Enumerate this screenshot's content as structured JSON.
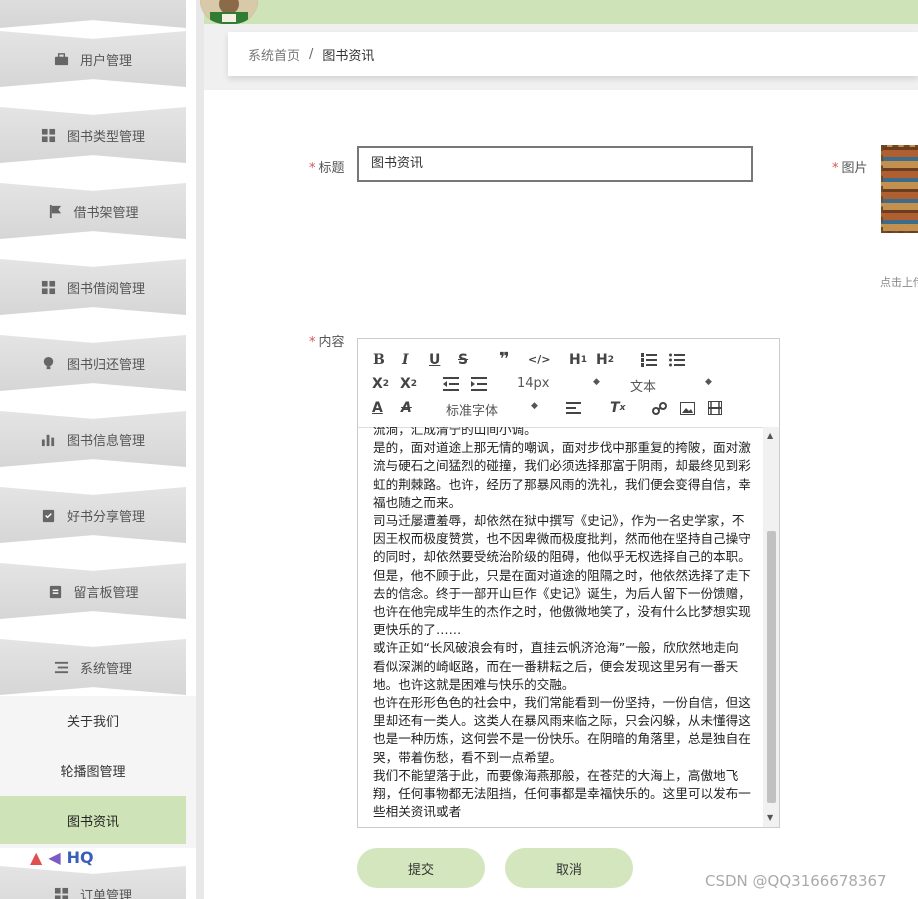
{
  "sidebar": {
    "menu": [
      {
        "label": "用户管理",
        "icon": "briefcase-icon"
      },
      {
        "label": "图书类型管理",
        "icon": "grid-icon"
      },
      {
        "label": "借书架管理",
        "icon": "flag-icon"
      },
      {
        "label": "图书借阅管理",
        "icon": "grid-icon"
      },
      {
        "label": "图书归还管理",
        "icon": "lightbulb-icon"
      },
      {
        "label": "图书信息管理",
        "icon": "bar-chart-icon"
      },
      {
        "label": "好书分享管理",
        "icon": "clipboard-check-icon"
      },
      {
        "label": "留言板管理",
        "icon": "clipboard-icon"
      },
      {
        "label": "系统管理",
        "icon": "list-icon"
      }
    ],
    "submenu": [
      "关于我们",
      "轮播图管理",
      "图书资讯"
    ],
    "order": {
      "label": "订单管理",
      "icon": "grid-icon"
    },
    "logo_text": "HQ"
  },
  "breadcrumb": {
    "home": "系统首页",
    "separator": "/",
    "current": "图书资讯"
  },
  "form": {
    "title_label": "标题",
    "title_value": "图书资讯",
    "image_label": "图片",
    "upload_tip": "点击上传",
    "content_label": "内容",
    "required_mark": "*"
  },
  "editor": {
    "font_size": "14px",
    "paragraph": "文本",
    "font_family": "标准字体",
    "toolbar_icons": [
      "bold-icon",
      "italic-icon",
      "underline-icon",
      "strike-icon",
      "quote-icon",
      "code-icon",
      "h1-icon",
      "h2-icon",
      "ordered-list-icon",
      "bullet-list-icon",
      "subscript-icon",
      "superscript-icon",
      "outdent-icon",
      "indent-icon",
      "font-color-icon",
      "highlight-icon",
      "align-icon",
      "clear-format-icon",
      "link-icon",
      "image-icon",
      "video-icon"
    ],
    "content": [
      "流淌，汇成清宁的山间小调。",
      "是的，面对道途上那无情的嘲讽，面对步伐中那重复的挎陂，面对激流与硬石之间猛烈的碰撞，我们必须选择那富于阴雨，却最终见到彩虹的荆棘路。也许，经历了那暴风雨的洗礼，我们便会变得自信，幸福也随之而来。",
      "司马迁屡遭羞辱，却依然在狱中撰写《史记》，作为一名史学家，不因王权而极度赞赏，也不因卑微而极度批判，然而他在坚持自己操守的同时，却依然要受统治阶级的阻碍，他似乎无权选择自己的本职。但是，他不顾于此，只是在面对道途的阻隔之时，他依然选择了走下去的信念。终于一部开山巨作《史记》诞生，为后人留下一份馈赠，也许在他完成毕生的杰作之时，他傲微地笑了，没有什么比梦想实现更快乐的了……",
      "或许正如“长风破浪会有时，直挂云帆济沧海”一般，欣欣然地走向看似深渊的崎岖路，而在一番耕耘之后，便会发现这里另有一番天地。也许这就是困难与快乐的交融。",
      "也许在形形色色的社会中，我们常能看到一份坚持，一份自信，但这里却还有一类人。这类人在暴风雨来临之际，只会闪躲，从未懂得这也是一种历炼，这何尝不是一份快乐。在阴暗的角落里，总是独自在哭，带着伤愁，看不到一点希望。",
      "我们不能望落于此，而要像海燕那般，在苍茫的大海上，高傲地飞翔，任何事物都无法阻挡，任何事都是幸福快乐的。这里可以发布一些相关资讯或者"
    ]
  },
  "buttons": {
    "submit": "提交",
    "cancel": "取消"
  },
  "watermark": "CSDN @QQ3166678367",
  "colors": {
    "accent": "#cfe3b8",
    "button": "#d3e6bd",
    "required": "#e05050"
  }
}
